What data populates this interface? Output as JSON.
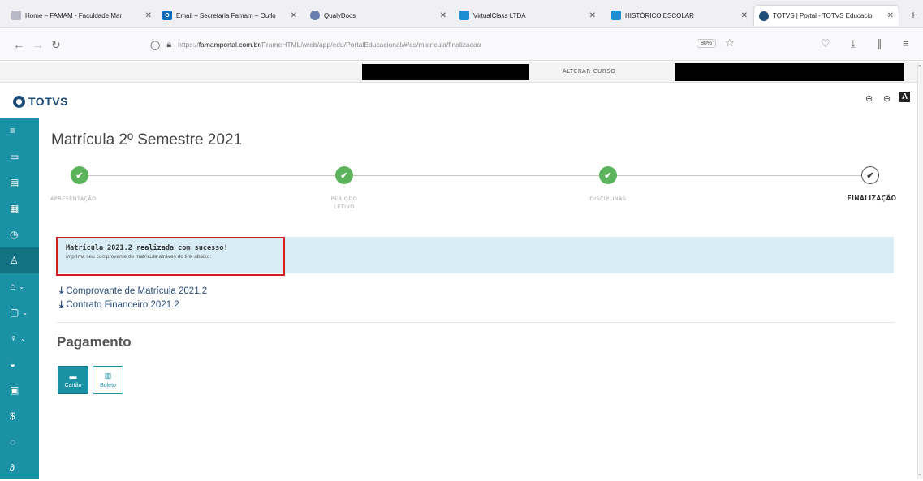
{
  "browser": {
    "tabs": [
      {
        "title": "Home – FAMAM - Faculdade Mar",
        "fav_color": "#b9b9c8",
        "fav_glyph": "☺",
        "active": false
      },
      {
        "title": "Email – Secretaria Famam – Outlo",
        "fav_color": "#0f6cbd",
        "fav_glyph": "O",
        "active": false
      },
      {
        "title": "QualyDocs",
        "fav_color": "#6a7fb0",
        "fav_glyph": "Q",
        "active": false
      },
      {
        "title": "VirtualClass LTDA",
        "fav_color": "#1d8ed1",
        "fav_glyph": "▣",
        "active": false
      },
      {
        "title": "HISTÓRICO ESCOLAR",
        "fav_color": "#1d8ed1",
        "fav_glyph": "▣",
        "active": false
      },
      {
        "title": "TOTVS | Portal - TOTVS Educacio",
        "fav_color": "#1f4d7a",
        "fav_glyph": "●",
        "active": true
      }
    ],
    "url_prefix": "https://",
    "url_host": "famamportal.com.br",
    "url_path": "/FrameHTML//web/app/edu/PortalEducacional/#/es/matricula/finalizacao",
    "zoom": "80%"
  },
  "topstrip": {
    "alterar_label": "ALTERAR CURSO"
  },
  "header": {
    "logo_text": "TOTVS",
    "text_size_label": "A"
  },
  "sidebar": {
    "items": [
      {
        "icon": "menu-icon",
        "glyph": "≡",
        "chevron": false,
        "active": false
      },
      {
        "icon": "monitor-icon",
        "glyph": "▭",
        "chevron": false,
        "active": false
      },
      {
        "icon": "calendar-icon",
        "glyph": "▤",
        "chevron": false,
        "active": false
      },
      {
        "icon": "grid-icon",
        "glyph": "▦",
        "chevron": false,
        "active": false
      },
      {
        "icon": "clock-icon",
        "glyph": "◷",
        "chevron": false,
        "active": false
      },
      {
        "icon": "user-add-icon",
        "glyph": "♙",
        "chevron": false,
        "active": true
      },
      {
        "icon": "graduation-icon",
        "glyph": "⌂",
        "chevron": true,
        "active": false
      },
      {
        "icon": "clipboard-icon",
        "glyph": "▢",
        "chevron": true,
        "active": false
      },
      {
        "icon": "lightbulb-icon",
        "glyph": "♀",
        "chevron": true,
        "active": false
      },
      {
        "icon": "inbox-icon",
        "glyph": "◒",
        "chevron": false,
        "active": false
      },
      {
        "icon": "document-icon",
        "glyph": "▣",
        "chevron": false,
        "active": false
      },
      {
        "icon": "dollar-icon",
        "glyph": "$",
        "chevron": false,
        "active": false
      },
      {
        "icon": "chat-icon",
        "glyph": "◌",
        "chevron": false,
        "active": false
      },
      {
        "icon": "link-icon",
        "glyph": "∂",
        "chevron": false,
        "active": false
      }
    ]
  },
  "main": {
    "title": "Matrícula 2º Semestre 2021",
    "steps": [
      {
        "label_line1": "APRESENTAÇÃO",
        "label_line2": "",
        "status": "done"
      },
      {
        "label_line1": "PERÍODO",
        "label_line2": "LETIVO",
        "status": "done"
      },
      {
        "label_line1": "DISCIPLINAS",
        "label_line2": "",
        "status": "done"
      },
      {
        "label_line1": "FINALIZAÇÃO",
        "label_line2": "",
        "status": "current"
      }
    ],
    "success_title": "Matrícula 2021.2 realizada com sucesso!",
    "success_sub": "Imprima seu comprovante de matrícula atráves do link abaixo:",
    "links": [
      {
        "label": "Comprovante de Matrícula 2021.2"
      },
      {
        "label": "Contrato Financeiro 2021.2"
      }
    ],
    "payment": {
      "title": "Pagamento",
      "options": [
        {
          "label": "Cartão",
          "selected": true
        },
        {
          "label": "Boleto",
          "selected": false
        }
      ]
    }
  },
  "colors": {
    "sidebar": "#1a91a5",
    "sidebar_active": "#137282",
    "step_done": "#5bb45b",
    "success_bg": "#d9edf6",
    "highlight": "#d11f24",
    "link": "#2a4e7c"
  }
}
